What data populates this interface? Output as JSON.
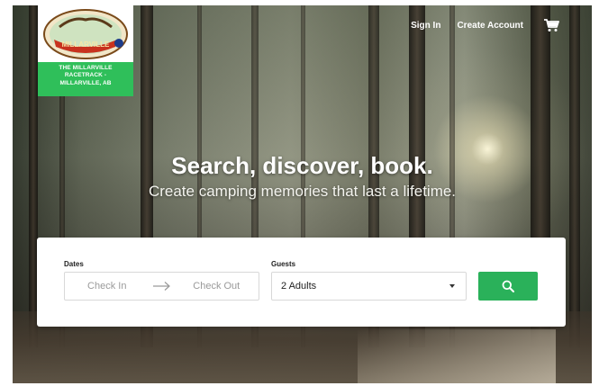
{
  "brand": {
    "emblem_text": "MILLARVILLE",
    "name_lines": [
      "THE MILLARVILLE",
      "RACETRACK -",
      "MILLARVILLE, AB"
    ]
  },
  "nav": {
    "sign_in": "Sign In",
    "create_account": "Create Account",
    "cart_icon": "shopping-cart-icon"
  },
  "hero": {
    "headline": "Search, discover, book.",
    "subheadline": "Create camping memories that last a lifetime."
  },
  "search": {
    "dates_label": "Dates",
    "check_in_placeholder": "Check In",
    "check_out_placeholder": "Check Out",
    "guests_label": "Guests",
    "guests_value": "2 Adults",
    "button_icon": "search-icon"
  },
  "colors": {
    "accent_green": "#2ab15a",
    "logo_green": "#2fbf5a"
  }
}
